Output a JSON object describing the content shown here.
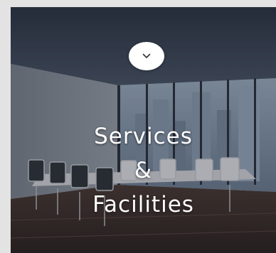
{
  "card": {
    "title_lines": [
      "Services",
      "&",
      "Facilities"
    ],
    "toggle_icon": "chevron-down-icon",
    "accent_color": "#ffffff"
  }
}
